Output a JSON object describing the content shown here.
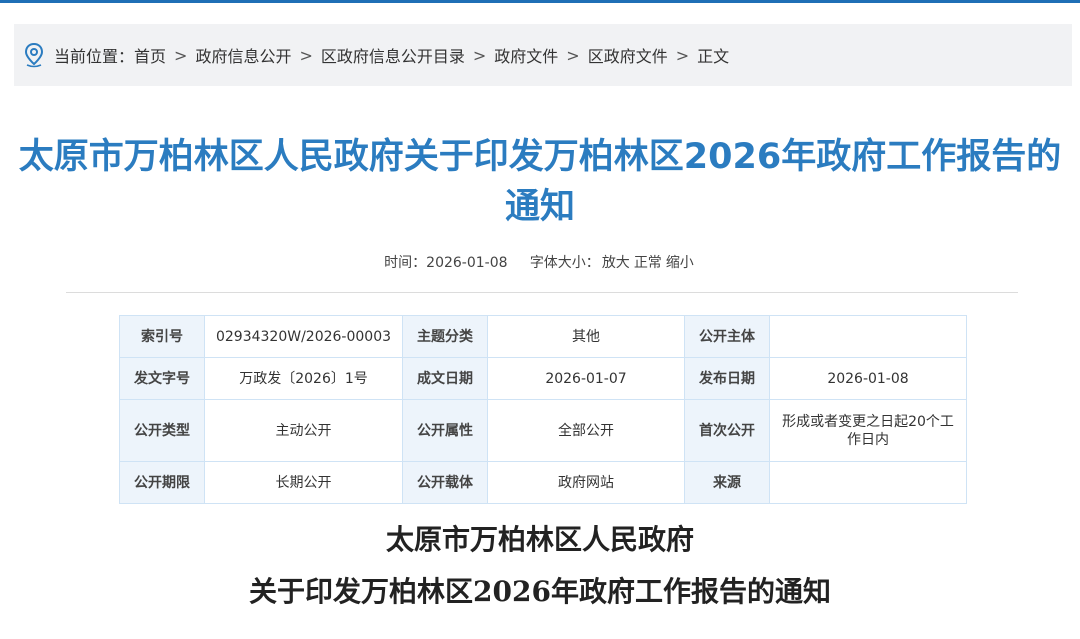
{
  "breadcrumb": {
    "prefix": "当前位置：",
    "items": [
      "首页",
      "政府信息公开",
      "区政府信息公开目录",
      "政府文件",
      "区政府文件",
      "正文"
    ],
    "separator": ">"
  },
  "article": {
    "title": "太原市万柏林区人民政府关于印发万柏林区2026年政府工作报告的通知",
    "time_label": "时间：",
    "time_value": "2026-01-08",
    "fontsize_label": "字体大小：",
    "fontsize_large": "放大",
    "fontsize_normal": "正常",
    "fontsize_small": "缩小"
  },
  "info_table": {
    "index_label": "索引号",
    "index_value": "02934320W/2026-00003",
    "topic_label": "主题分类",
    "topic_value": "其他",
    "publisher_label": "公开主体",
    "publisher_value": "",
    "docno_label": "发文字号",
    "docno_value": "万政发〔2026〕1号",
    "created_label": "成文日期",
    "created_value": "2026-01-07",
    "published_label": "发布日期",
    "published_value": "2026-01-08",
    "type_label": "公开类型",
    "type_value": "主动公开",
    "attr_label": "公开属性",
    "attr_value": "全部公开",
    "first_label": "首次公开",
    "first_value": "形成或者变更之日起20个工作日内",
    "period_label": "公开期限",
    "period_value": "长期公开",
    "carrier_label": "公开载体",
    "carrier_value": "政府网站",
    "source_label": "来源",
    "source_value": ""
  },
  "document": {
    "head_line1": "太原市万柏林区人民政府",
    "head_line2": "关于印发万柏林区2026年政府工作报告的通知"
  },
  "colors": {
    "title_blue": "#2b7cc0",
    "label_bg": "#edf4fb",
    "border": "#cfe3f5",
    "breadcrumb_bg": "#f1f2f4"
  }
}
